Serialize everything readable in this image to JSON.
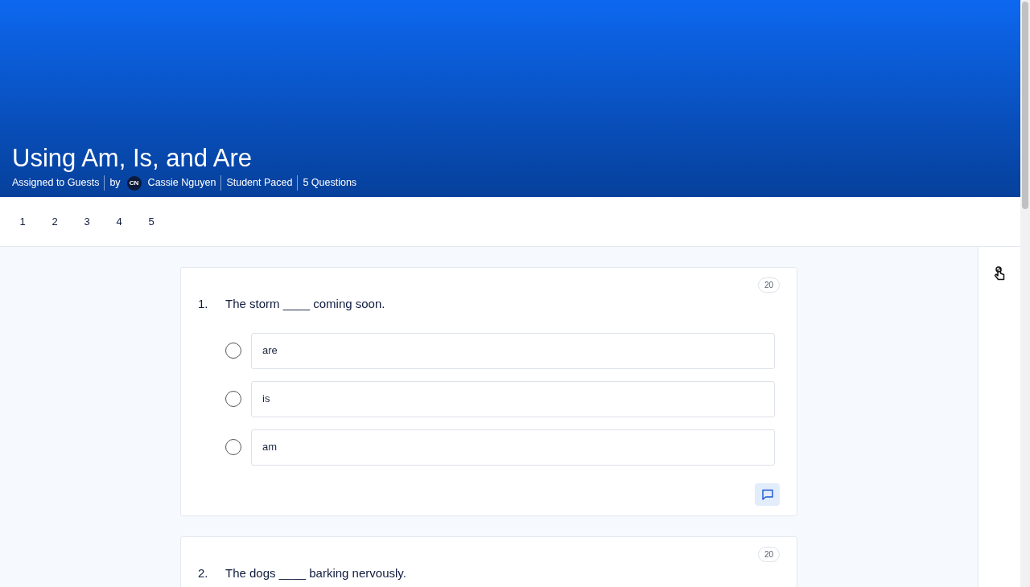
{
  "header": {
    "title": "Using Am, Is, and Are",
    "meta": [
      {
        "kind": "text",
        "text": "Assigned to Guests"
      },
      {
        "kind": "author",
        "prefix": "by",
        "initials": "CN",
        "name": "Cassie Nguyen"
      },
      {
        "kind": "text",
        "text": "Student Paced"
      },
      {
        "kind": "text",
        "text": "5 Questions"
      }
    ]
  },
  "question_nav": [
    "1",
    "2",
    "3",
    "4",
    "5"
  ],
  "questions": [
    {
      "number": "1.",
      "text": "The storm ____ coming soon.",
      "points": "20",
      "options": [
        {
          "label": "are",
          "selected": false
        },
        {
          "label": "is",
          "selected": false
        },
        {
          "label": "am",
          "selected": false
        }
      ],
      "comment_button": true
    },
    {
      "number": "2.",
      "text": "The dogs ____ barking nervously.",
      "points": "20"
    }
  ]
}
